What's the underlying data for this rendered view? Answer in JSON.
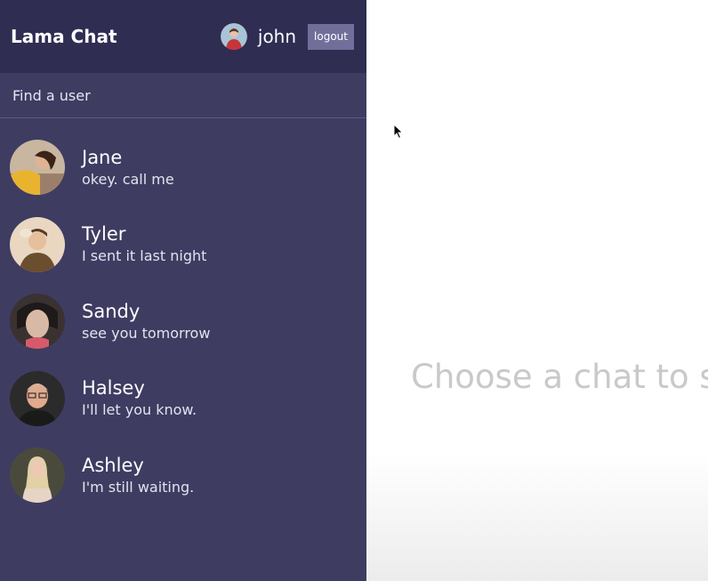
{
  "app": {
    "title": "Lama Chat"
  },
  "navbar": {
    "username": "john",
    "logout_label": "logout",
    "avatar_icon": "user-avatar"
  },
  "search": {
    "placeholder": "Find a user",
    "value": ""
  },
  "chats": [
    {
      "name": "Jane",
      "last_message": "okey. call me"
    },
    {
      "name": "Tyler",
      "last_message": "I sent it last night"
    },
    {
      "name": "Sandy",
      "last_message": "see you tomorrow"
    },
    {
      "name": "Halsey",
      "last_message": "I'll let you know."
    },
    {
      "name": "Ashley",
      "last_message": "I'm still waiting."
    }
  ],
  "main": {
    "empty_message": "Choose a chat to s"
  },
  "colors": {
    "navbar_bg": "#2f2d52",
    "sidebar_bg": "#3f3c62",
    "logout_bg": "#716f9a",
    "empty_text": "#c9c9c9"
  }
}
